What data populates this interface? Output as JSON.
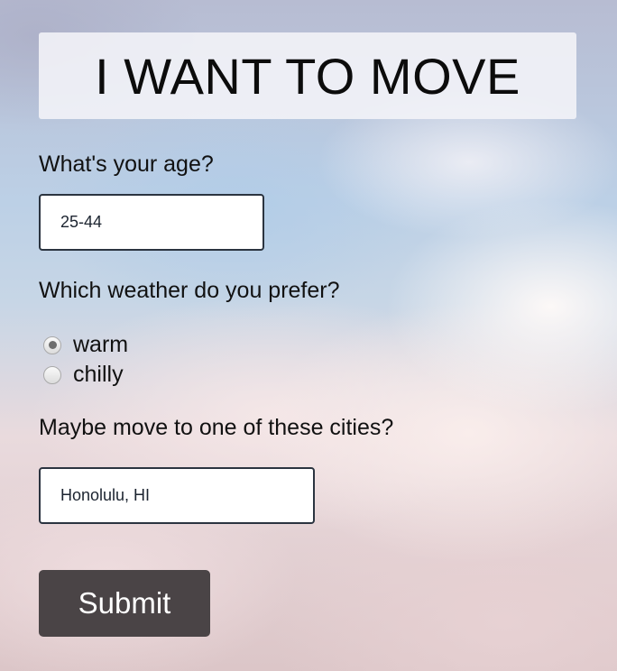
{
  "header": {
    "title": "I WANT TO MOVE"
  },
  "age": {
    "label": "What's your age?",
    "value": "25-44"
  },
  "weather": {
    "label": "Which weather do you prefer?",
    "options": [
      {
        "label": "warm",
        "selected": true
      },
      {
        "label": "chilly",
        "selected": false
      }
    ]
  },
  "city": {
    "label": "Maybe move to one of these cities?",
    "value": "Honolulu, HI"
  },
  "submit": {
    "label": "Submit"
  }
}
